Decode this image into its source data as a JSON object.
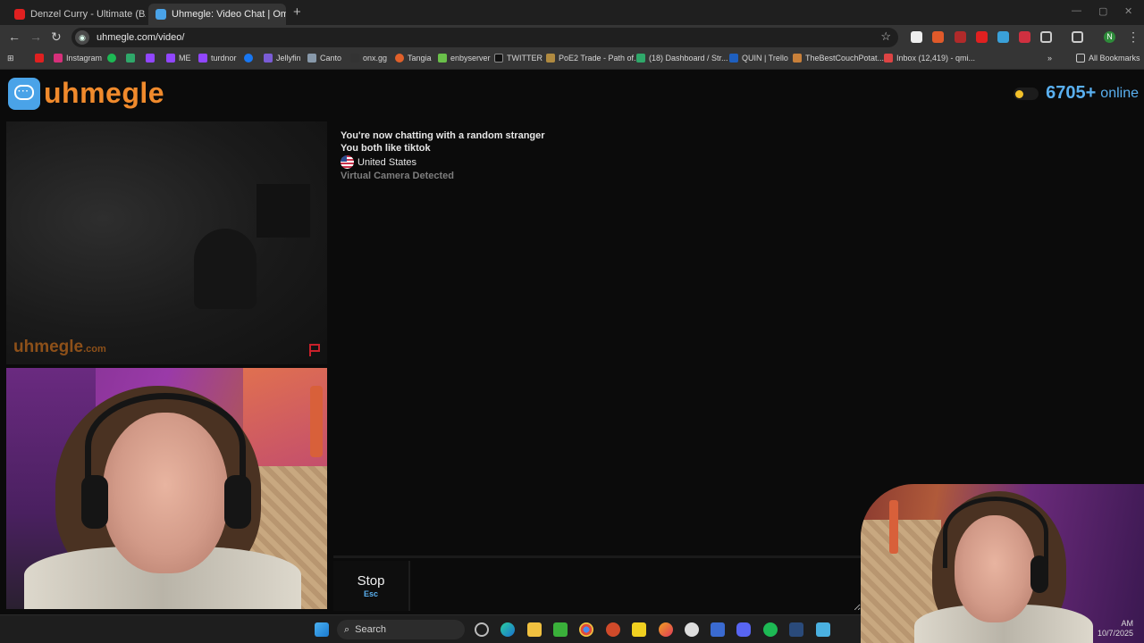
{
  "browser": {
    "tabs": [
      {
        "title": "Denzel Curry - Ultimate (BADB...",
        "favicon_color": "#e02020",
        "active": false
      },
      {
        "title": "Uhmegle: Video Chat | Omi...",
        "favicon_color": "#4aa3e8",
        "active": true
      }
    ],
    "new_tab_glyph": "+",
    "url": "uhmegle.com/video/",
    "bookmarks": [
      {
        "label": "",
        "icon_color": "#e02020"
      },
      {
        "label": "Instagram",
        "icon_color": "#d6307a"
      },
      {
        "label": "",
        "icon_color": "#1db954"
      },
      {
        "label": "",
        "icon_color": "#2fa86a"
      },
      {
        "label": "",
        "icon_color": "#9146ff"
      },
      {
        "label": "ME",
        "icon_color": "#9146ff"
      },
      {
        "label": "turdnor",
        "icon_color": "#9146ff"
      },
      {
        "label": "",
        "icon_color": "#1877f2"
      },
      {
        "label": "Jellyfin",
        "icon_color": "#7a5cd6"
      },
      {
        "label": "Canto",
        "icon_color": "#8899aa"
      },
      {
        "label": "onx.gg",
        "icon_color": "#333"
      },
      {
        "label": "Tangia",
        "icon_color": "#e0602a"
      },
      {
        "label": "enbyserver",
        "icon_color": "#6ac04a"
      },
      {
        "label": "TWITTER",
        "icon_color": "#111"
      },
      {
        "label": "PoE2 Trade - Path of...",
        "icon_color": "#b08a40"
      },
      {
        "label": "(18) Dashboard / Str...",
        "icon_color": "#2fa86a"
      },
      {
        "label": "QUIN | Trello",
        "icon_color": "#1e5fbf"
      },
      {
        "label": "TheBestCouchPotat...",
        "icon_color": "#c8803a"
      },
      {
        "label": "Inbox (12,419) - qmi...",
        "icon_color": "#d44"
      }
    ],
    "all_bookmarks_label": "All Bookmarks",
    "profile_initial": "N"
  },
  "site": {
    "logo_text": "uhmegle",
    "online_count": "6705+",
    "online_word": "online",
    "watermark_main": "uhmegle",
    "watermark_suffix": ".com"
  },
  "chat": {
    "line1": "You're now chatting with a random stranger",
    "line2": "You both like tiktok",
    "country": "United States",
    "warning": "Virtual Camera Detected"
  },
  "controls": {
    "stop_label": "Stop",
    "stop_key": "Esc",
    "message_placeholder": ""
  },
  "taskbar": {
    "search_label": "Search",
    "time": "AM",
    "date": "10/7/2025"
  },
  "colors": {
    "accent_orange": "#f08a2c",
    "accent_blue": "#5ab0f0"
  }
}
